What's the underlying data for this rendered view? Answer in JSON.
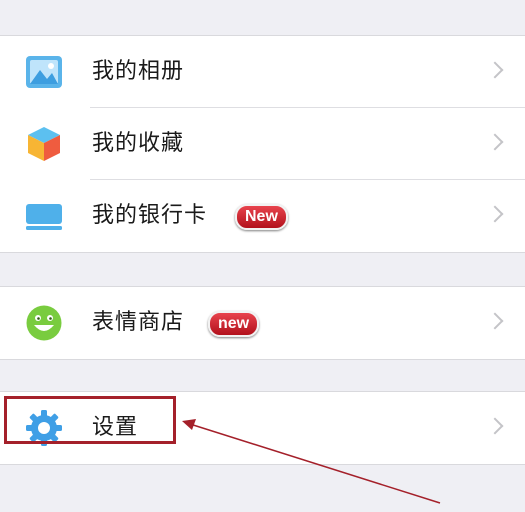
{
  "groups": {
    "first": {
      "items": [
        {
          "label": "我的相册",
          "icon": "photo-album-icon"
        },
        {
          "label": "我的收藏",
          "icon": "favorites-cube-icon"
        },
        {
          "label": "我的银行卡",
          "icon": "bank-card-icon",
          "badge": "New"
        }
      ]
    },
    "second": {
      "items": [
        {
          "label": "表情商店",
          "icon": "smiley-face-icon",
          "badge": "new"
        }
      ]
    },
    "third": {
      "items": [
        {
          "label": "设置",
          "icon": "gear-icon"
        }
      ]
    }
  },
  "colors": {
    "background": "#efeff4",
    "badge": "#c8202b",
    "annotation": "#a4202a"
  }
}
